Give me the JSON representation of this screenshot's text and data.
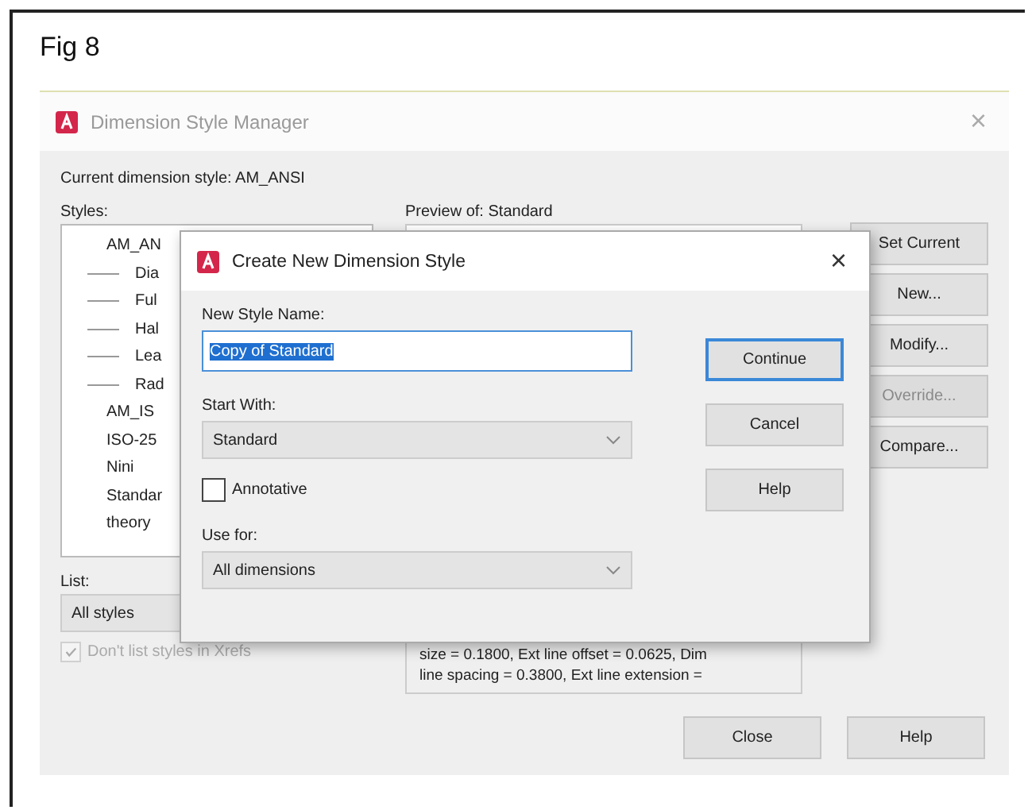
{
  "figure": {
    "caption": "Fig 8"
  },
  "window": {
    "title": "Dimension Style Manager",
    "close": "×"
  },
  "current_style": "Current dimension style: AM_ANSI",
  "styles": {
    "label": "Styles:",
    "items": [
      {
        "name": "AM_AN",
        "children": [
          {
            "name": "Dia"
          },
          {
            "name": "Ful"
          },
          {
            "name": "Hal"
          },
          {
            "name": "Lea"
          },
          {
            "name": "Rad"
          }
        ]
      },
      {
        "name": "AM_IS"
      },
      {
        "name": "ISO-25"
      },
      {
        "name": "Nini"
      },
      {
        "name": "Standar"
      },
      {
        "name": "theory"
      }
    ]
  },
  "list": {
    "label": "List:",
    "value": "All styles",
    "xref_checkbox": {
      "label": "Don't list styles in Xrefs",
      "checked": true,
      "disabled": true
    }
  },
  "preview": {
    "label": "Preview of: Standard"
  },
  "description": [
    "size = 0.1800, Ext line offset = 0.0625, Dim",
    "line spacing = 0.3800, Ext line extension ="
  ],
  "side_buttons": [
    {
      "label": "Set Current",
      "disabled": false
    },
    {
      "label": "New...",
      "disabled": false
    },
    {
      "label": "Modify...",
      "disabled": false
    },
    {
      "label": "Override...",
      "disabled": true
    },
    {
      "label": "Compare...",
      "disabled": false
    }
  ],
  "bottom_buttons": [
    {
      "label": "Close"
    },
    {
      "label": "Help"
    }
  ],
  "dialog": {
    "title": "Create New Dimension Style",
    "close": "×",
    "name_label": "New Style Name:",
    "name_value": "Copy of Standard",
    "name_highlighted": true,
    "start_label": "Start With:",
    "start_value": "Standard",
    "annotative": {
      "label": "Annotative",
      "checked": false
    },
    "use_label": "Use for:",
    "use_value": "All dimensions",
    "buttons": [
      {
        "label": "Continue",
        "default": true
      },
      {
        "label": "Cancel",
        "default": false
      },
      {
        "label": "Help",
        "default": false
      }
    ]
  }
}
